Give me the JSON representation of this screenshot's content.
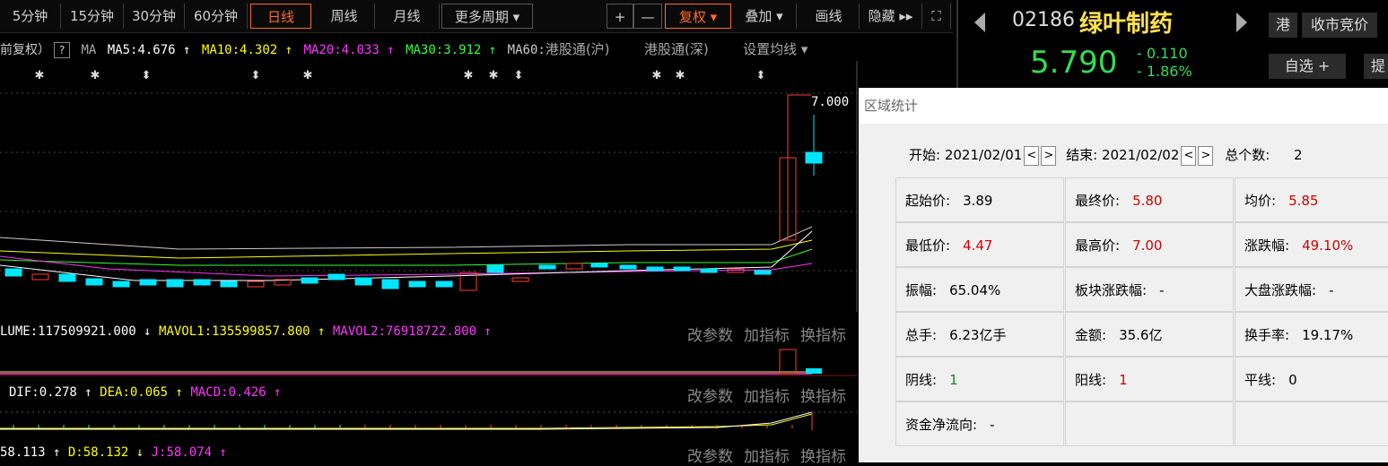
{
  "toolbar": {
    "periods": [
      "5分钟",
      "15分钟",
      "30分钟",
      "60分钟",
      "日线",
      "周线",
      "月线",
      "更多周期 ▾"
    ],
    "active": "日线",
    "plus": "+",
    "minus": "—",
    "fuquan": "复权 ▾",
    "overlay": "叠加 ▾",
    "draw": "画线",
    "hide": "隐藏 ▸▸",
    "fullscreen": "⛶"
  },
  "ma_line": {
    "prefix": "前复权）",
    "q": "?",
    "ma": "MA",
    "ma5": "MA5:4.676 ↑",
    "ma10": "MA10:4.302 ↑",
    "ma20": "MA20:4.033 ↑",
    "ma30": "MA30:3.912 ↑",
    "ma60": "MA60:",
    "hk_sh": "港股通(沪)",
    "hk_sz": "港股通(深)",
    "set_ma": "设置均线 ▾"
  },
  "header": {
    "code": "02186",
    "name": "绿叶制药",
    "price": "5.790",
    "change": "- 0.110",
    "change_pct": "- 1.86%",
    "hk_tag": "港",
    "auction": "收市竞价",
    "watch": "自选 +",
    "extra": "提"
  },
  "price_chart": {
    "high_label": "7.000"
  },
  "volume_panel": {
    "label_vol": "LUME:117509921.000 ↓",
    "label_mavol1": "MAVOL1:135599857.800 ↑",
    "label_mavol2": "MAVOL2:76918722.800 ↑"
  },
  "macd_panel": {
    "label_dif": "DIF:0.278 ↑",
    "label_dea": "DEA:0.065 ↑",
    "label_macd": "MACD:0.426 ↑"
  },
  "kdj_panel": {
    "label_k": "58.113 ↑",
    "label_d": "D:58.132 ↓",
    "label_j": "J:58.074 ↑"
  },
  "panel_buttons": [
    "改参数",
    "加指标",
    "换指标"
  ],
  "dialog": {
    "title": "区域统计",
    "start_label": "开始:",
    "start_date": "2021/02/01",
    "end_label": "结束:",
    "end_date": "2021/02/02",
    "count_label": "总个数:",
    "count": "2",
    "prev": "<",
    "next": ">",
    "cells": [
      {
        "label": "起始价:",
        "value": "3.89",
        "color": "black"
      },
      {
        "label": "最终价:",
        "value": "5.80",
        "color": "red"
      },
      {
        "label": "均价:",
        "value": "5.85",
        "color": "red"
      },
      {
        "label": "最低价:",
        "value": "4.47",
        "color": "red"
      },
      {
        "label": "最高价:",
        "value": "7.00",
        "color": "red"
      },
      {
        "label": "涨跌幅:",
        "value": "49.10%",
        "color": "red"
      },
      {
        "label": "振幅:",
        "value": "65.04%",
        "color": "black"
      },
      {
        "label": "板块涨跌幅:",
        "value": "-",
        "color": "black"
      },
      {
        "label": "大盘涨跌幅:",
        "value": "-",
        "color": "black"
      },
      {
        "label": "总手:",
        "value": "6.23亿手",
        "color": "black"
      },
      {
        "label": "金额:",
        "value": "35.6亿",
        "color": "black"
      },
      {
        "label": "换手率:",
        "value": "19.17%",
        "color": "black"
      },
      {
        "label": "阴线:",
        "value": "1",
        "color": "green"
      },
      {
        "label": "阳线:",
        "value": "1",
        "color": "red"
      },
      {
        "label": "平线:",
        "value": "0",
        "color": "black"
      },
      {
        "label": "资金净流向:",
        "value": "-",
        "color": "black"
      },
      {
        "label": "",
        "value": "",
        "color": "black"
      },
      {
        "label": "",
        "value": "",
        "color": "black"
      }
    ]
  },
  "colors": {
    "up": "#ff3b3b",
    "down": "#00e5ff",
    "ma5": "#ffffff",
    "ma10": "#ffff00",
    "ma20": "#ff33ff",
    "ma30": "#33ff33",
    "accent": "#ff6a2a"
  }
}
